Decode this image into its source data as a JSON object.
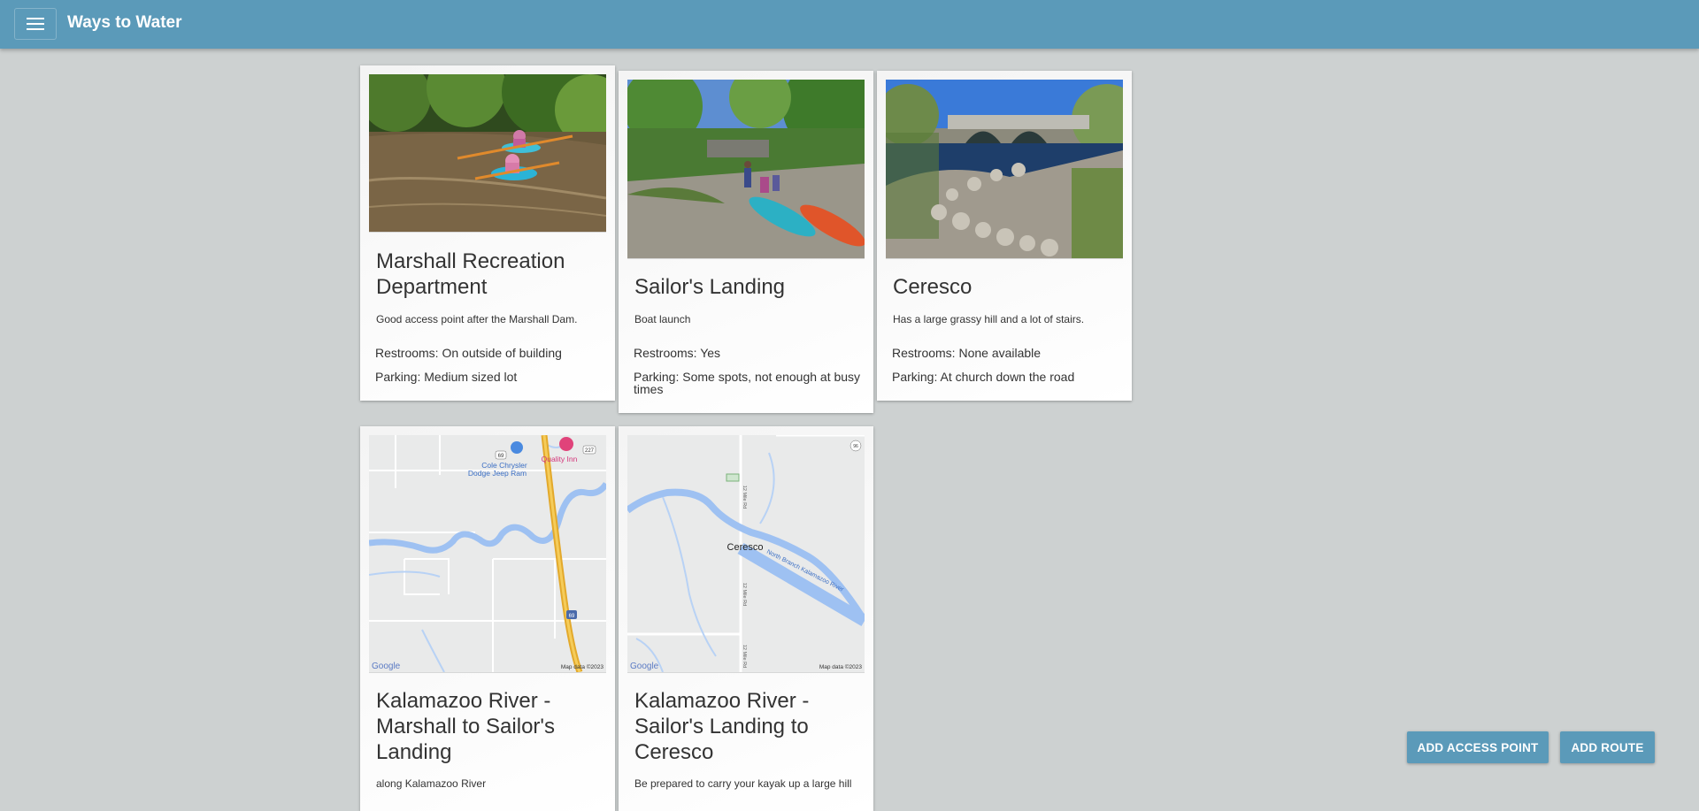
{
  "app": {
    "title": "Ways to Water"
  },
  "access_points": [
    {
      "title": "Marshall Recreation Department",
      "description": "Good access point after the Marshall Dam.",
      "restrooms": "Restrooms: On outside of building",
      "parking": "Parking: Medium sized lot"
    },
    {
      "title": "Sailor's Landing",
      "description": "Boat launch",
      "restrooms": "Restrooms: Yes",
      "parking": "Parking: Some spots, not enough at busy times"
    },
    {
      "title": "Ceresco",
      "description": "Has a large grassy hill and a lot of stairs.",
      "restrooms": "Restrooms: None available",
      "parking": "Parking: At church down the road"
    }
  ],
  "routes": [
    {
      "title": "Kalamazoo River - Marshall to Sailor's Landing",
      "description": "along Kalamazoo River",
      "map": {
        "labels": [
          "Cole Chrysler",
          "Dodge Jeep Ram",
          "Quality Inn",
          "69",
          "227",
          "69"
        ],
        "google": "Google",
        "attribution": "Map data ©2023"
      }
    },
    {
      "title": "Kalamazoo River - Sailor's Landing to Ceresco",
      "description": "Be prepared to carry your kayak up a large hill",
      "map": {
        "labels": [
          "Ceresco",
          "North Branch Kalamazoo River",
          "12 Mile Rd",
          "12 Mile Rd",
          "12 Mile Rd",
          "96"
        ],
        "google": "Google",
        "attribution": "Map data ©2023"
      }
    }
  ],
  "actions": {
    "add_access_point": "ADD ACCESS POINT",
    "add_route": "ADD ROUTE"
  },
  "colors": {
    "appbar": "#5b9ab9",
    "background": "#cdd1d1",
    "button": "#5b9ab9"
  }
}
